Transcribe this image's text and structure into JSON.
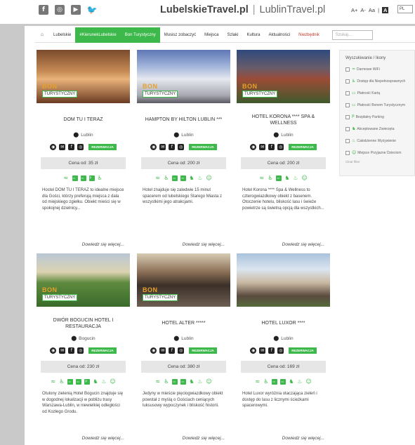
{
  "header": {
    "social_icons": [
      "facebook-icon",
      "instagram-icon",
      "youtube-icon",
      "twitter-icon"
    ],
    "brand_primary": "LubelskieTravel.pl",
    "brand_separator": "|",
    "brand_secondary": "LublinTravel.pl",
    "font_controls": [
      "A+",
      "A-",
      "Aa",
      "|",
      "A"
    ],
    "language": "PL"
  },
  "nav": {
    "items": [
      {
        "label": "Lubelskie",
        "style": "normal"
      },
      {
        "label": "#KierunekLubelskie",
        "style": "green"
      },
      {
        "label": "Bon Turystyczny",
        "style": "green"
      },
      {
        "label": "Musisz zobaczyć",
        "style": "normal"
      },
      {
        "label": "Miejsca",
        "style": "normal"
      },
      {
        "label": "Szlaki",
        "style": "normal"
      },
      {
        "label": "Kultura",
        "style": "normal"
      },
      {
        "label": "Aktualności",
        "style": "normal"
      },
      {
        "label": "Niezbędnik",
        "style": "red"
      }
    ],
    "search_placeholder": "Szukaj..."
  },
  "badge": {
    "line1": "BON",
    "line2": "TURYSTYCZNY"
  },
  "card_common": {
    "reservation_label": "REZERWACJA",
    "more_label": "Dowiedz się więcej..."
  },
  "cards": [
    {
      "name": "DOM TU I TERAZ",
      "city": "Lublin",
      "price": "Cena od: 35 zł",
      "description": "Hostel DOM TU I TERAZ to idealne miejsce dla Gości, którzy preferują miejsca z dala od miejskiego zgiełku. Obiekt mieści się w spokojnej dzielnicy..."
    },
    {
      "name": "HAMPTON BY HILTON LUBLIN ***",
      "city": "Lublin",
      "price": "Cena od: 200 zł",
      "description": "Hotel znajduje się zaledwie 15 minut spacerem od lubelskiego Starego Miasta z wszystkimi jego atrakcjami."
    },
    {
      "name": "HOTEL KORONA **** SPA & WELLNESS",
      "city": "Lublin",
      "price": "Cena od: 200 zł",
      "description": "Hotel Korona **** Spa & Wellness to czterogwiazdkowy obiekt z basenem. Otoczenie hotelu, bliskość lasu i świeże powietrze są świetną opcją dla wszystkich..."
    },
    {
      "name": "DWÓR BOGUCIN HOTEL I RESTAURACJA",
      "city": "Bogucin",
      "price": "Cena od: 230 zł",
      "description": "Otulony zielenią Hotel Bogucin znajduje się w dogodnej lokalizacji w pobliżu trasy Warszawa-Lublin, w niewielkiej odległości od Kozłego Grodu."
    },
    {
      "name": "HOTEL ALTER *****",
      "city": "Lublin",
      "price": "Cena od: 380 zł",
      "description": "Jedyny w mieście pięciogwiazdkowy obiekt powstał z myślą o Gościach ceniących luksusowy wypoczynek i bliskość historii."
    },
    {
      "name": "HOTEL LUXOR ****",
      "city": "Lublin",
      "price": "Cena od: 169 zł",
      "description": "Hotel Luxor wyróżnia otaczająca zieleń i dostęp do lasu z licznymi ścieżkami spacerowymi."
    }
  ],
  "filters": {
    "title": "Wyszukiwanie / Ikony",
    "options": [
      {
        "label": "Darmowe WiFi",
        "icon": "wifi-icon"
      },
      {
        "label": "Dostęp dla Niepełnosprawnych",
        "icon": "wheelchair-icon"
      },
      {
        "label": "Płatność Kartą",
        "icon": "card-icon"
      },
      {
        "label": "Płatność Bonem Turystycznym",
        "icon": "voucher-icon"
      },
      {
        "label": "Bezpłatny Parking",
        "icon": "parking-icon"
      },
      {
        "label": "Akceptowane Zwierzęta",
        "icon": "pet-icon"
      },
      {
        "label": "Całodzienne Wyżywienie",
        "icon": "food-icon"
      },
      {
        "label": "Miejsce Przyjazne Dzieciom",
        "icon": "child-icon"
      }
    ],
    "clear_label": "Clear filter"
  },
  "colors": {
    "accent_green": "#3db84a",
    "bon_orange": "#e6a12a",
    "frame_gray": "#c9c9c9"
  }
}
